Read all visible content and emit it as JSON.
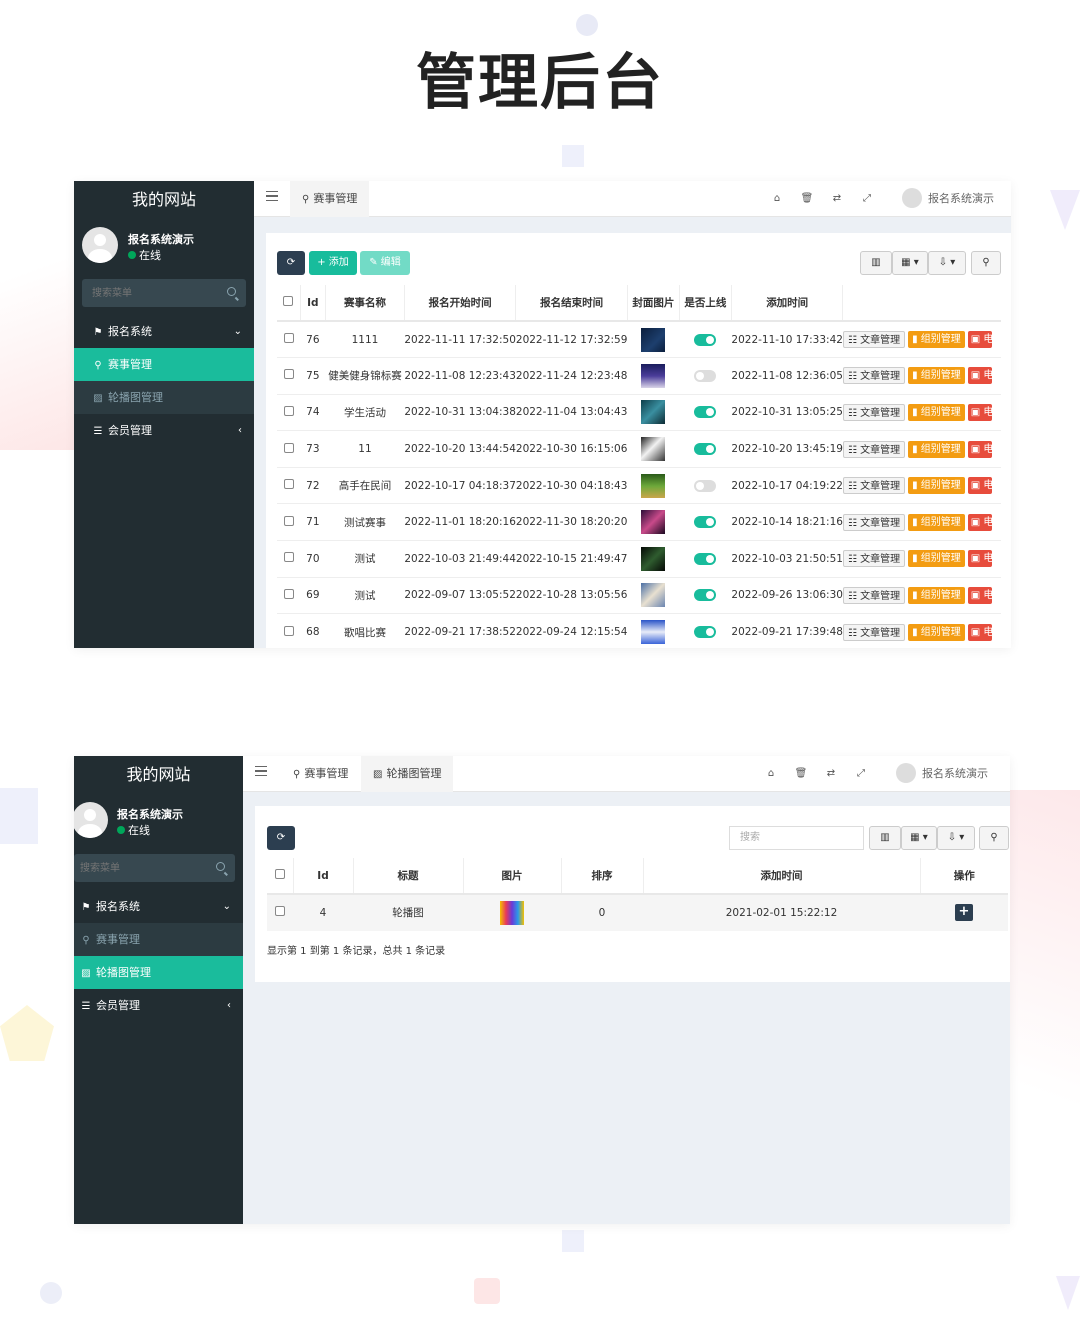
{
  "page_title": "管理后台",
  "colors": {
    "sidebar": "#222d32",
    "accent": "#18bc9c",
    "orange": "#f39c12",
    "red": "#e74c3c",
    "dark": "#2c3e50"
  },
  "screen1": {
    "sidebar": {
      "logo": "我的网站",
      "username": "报名系统演示",
      "status": "在线",
      "search_placeholder": "搜索菜单",
      "menu": [
        {
          "label": "报名系统",
          "icon": "flag-icon",
          "arrow": "⌄"
        },
        {
          "label": "赛事管理",
          "icon": "map-marker-icon"
        },
        {
          "label": "轮播图管理",
          "icon": "image-icon"
        },
        {
          "label": "会员管理",
          "icon": "list-icon",
          "arrow": "‹"
        }
      ]
    },
    "topbar": {
      "tabs": [
        "赛事管理"
      ],
      "user": "报名系统演示"
    },
    "toolbar": {
      "add": "+ 添加",
      "edit": "✎ 编辑"
    },
    "table": {
      "headers": [
        "Id",
        "赛事名称",
        "报名开始时间",
        "报名结束时间",
        "封面图片",
        "是否上线",
        "添加时间"
      ],
      "op_labels": [
        "☷ 文章管理",
        "▮ 组别管理",
        "▣ 电"
      ],
      "rows": [
        {
          "id": "76",
          "name": "1111",
          "start": "2022-11-11 17:32:50",
          "end": "2022-11-12 17:32:59",
          "online": true,
          "added": "2022-11-10 17:33:42"
        },
        {
          "id": "75",
          "name": "健美健身锦标赛",
          "start": "2022-11-08 12:23:43",
          "end": "2022-11-24 12:23:48",
          "online": false,
          "added": "2022-11-08 12:36:05"
        },
        {
          "id": "74",
          "name": "学生活动",
          "start": "2022-10-31 13:04:38",
          "end": "2022-11-04 13:04:43",
          "online": true,
          "added": "2022-10-31 13:05:25"
        },
        {
          "id": "73",
          "name": "11",
          "start": "2022-10-20 13:44:54",
          "end": "2022-10-30 16:15:06",
          "online": true,
          "added": "2022-10-20 13:45:19"
        },
        {
          "id": "72",
          "name": "高手在民间",
          "start": "2022-10-17 04:18:37",
          "end": "2022-10-30 04:18:43",
          "online": false,
          "added": "2022-10-17 04:19:22"
        },
        {
          "id": "71",
          "name": "测试赛事",
          "start": "2022-11-01 18:20:16",
          "end": "2022-11-30 18:20:20",
          "online": true,
          "added": "2022-10-14 18:21:16"
        },
        {
          "id": "70",
          "name": "测试",
          "start": "2022-10-03 21:49:44",
          "end": "2022-10-15 21:49:47",
          "online": true,
          "added": "2022-10-03 21:50:51"
        },
        {
          "id": "69",
          "name": "测试",
          "start": "2022-09-07 13:05:52",
          "end": "2022-10-28 13:05:56",
          "online": true,
          "added": "2022-09-26 13:06:30"
        },
        {
          "id": "68",
          "name": "歌唱比赛",
          "start": "2022-09-21 17:38:52",
          "end": "2022-09-24 12:15:54",
          "online": true,
          "added": "2022-09-21 17:39:48"
        }
      ]
    }
  },
  "screen2": {
    "sidebar": {
      "logo": "我的网站",
      "username": "报名系统演示",
      "status": "在线",
      "search_placeholder": "搜索菜单",
      "menu": [
        {
          "label": "报名系统",
          "icon": "flag-icon",
          "arrow": "⌄"
        },
        {
          "label": "赛事管理",
          "icon": "map-marker-icon"
        },
        {
          "label": "轮播图管理",
          "icon": "image-icon"
        },
        {
          "label": "会员管理",
          "icon": "list-icon",
          "arrow": "‹"
        }
      ]
    },
    "topbar": {
      "tabs": [
        "赛事管理",
        "轮播图管理"
      ],
      "user": "报名系统演示"
    },
    "search_placeholder": "搜索",
    "table": {
      "headers": [
        "Id",
        "标题",
        "图片",
        "排序",
        "添加时间",
        "操作"
      ],
      "rows": [
        {
          "id": "4",
          "title": "轮播图",
          "sort": "0",
          "added": "2021-02-01 15:22:12"
        }
      ]
    },
    "pagination": "显示第 1 到第 1 条记录，总共 1 条记录"
  }
}
